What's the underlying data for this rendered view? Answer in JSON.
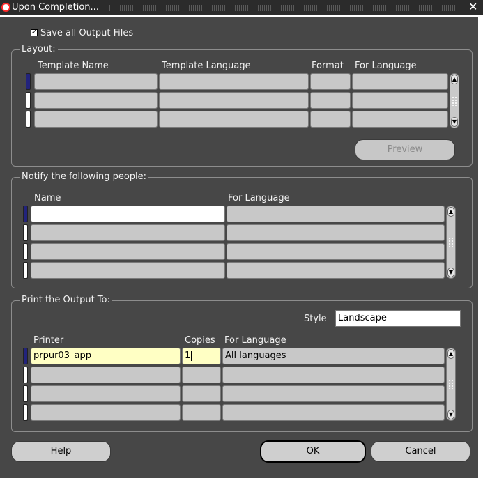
{
  "window": {
    "title": "Upon Completion...",
    "close_glyph": "✕"
  },
  "save_all": {
    "label": "Save all Output Files",
    "checked": true,
    "check_glyph": "✓"
  },
  "layout": {
    "group_title": "Layout:",
    "columns": [
      "Template Name",
      "Template Language",
      "Format",
      "For Language"
    ],
    "rows": [
      [
        "",
        "",
        "",
        ""
      ],
      [
        "",
        "",
        "",
        ""
      ],
      [
        "",
        "",
        "",
        ""
      ]
    ],
    "preview_label": "Preview"
  },
  "notify": {
    "group_title": "Notify the following people:",
    "columns": [
      "Name",
      "For Language"
    ],
    "rows": [
      [
        "",
        ""
      ],
      [
        "",
        ""
      ],
      [
        "",
        ""
      ],
      [
        "",
        ""
      ]
    ]
  },
  "print": {
    "group_title": "Print the Output To:",
    "style_label": "Style",
    "style_value": "Landscape",
    "columns": [
      "Printer",
      "Copies",
      "For Language"
    ],
    "rows": [
      [
        "prpur03_app",
        "1",
        "All languages"
      ],
      [
        "",
        "",
        ""
      ],
      [
        "",
        "",
        ""
      ],
      [
        "",
        "",
        ""
      ]
    ]
  },
  "buttons": {
    "help": "Help",
    "ok": "OK",
    "cancel": "Cancel"
  },
  "colors": {
    "active_indicator": "#22237c",
    "current_field": "#ffffc4",
    "logo_red": "#ff2a2a"
  }
}
